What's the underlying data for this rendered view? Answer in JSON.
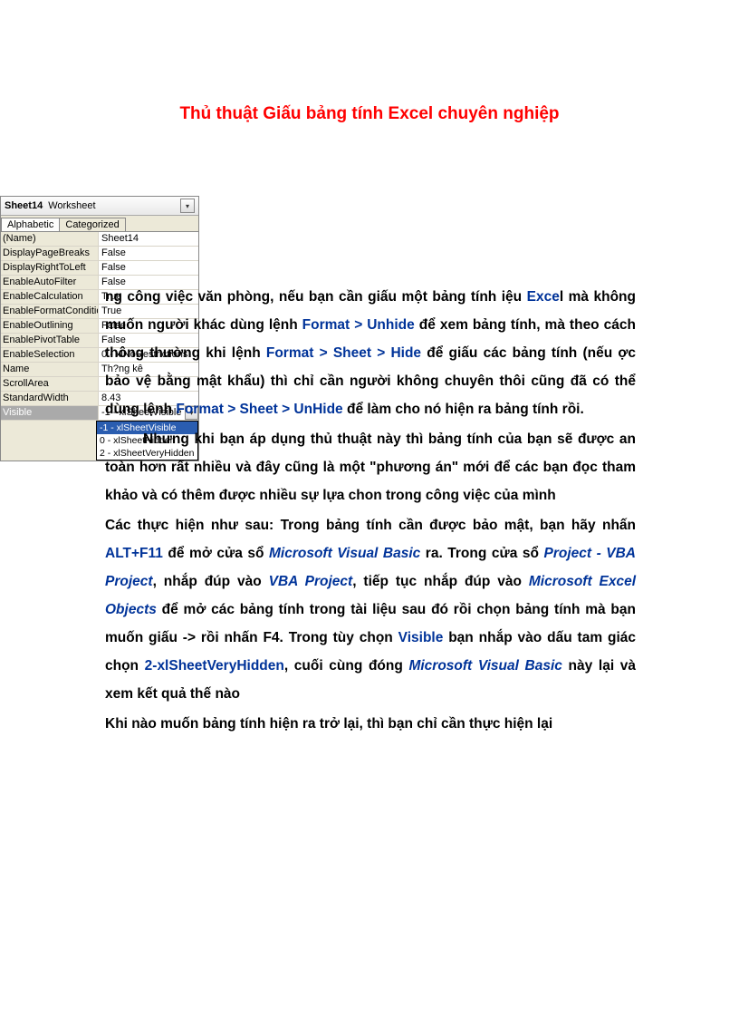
{
  "title": "Thủ thuật Giấu bảng tính Excel chuyên nghiệp",
  "panel": {
    "header_bold": "Sheet14",
    "header_plain": "Worksheet",
    "tab_alpha": "Alphabetic",
    "tab_cat": "Categorized",
    "rows": [
      {
        "k": "(Name)",
        "v": "Sheet14"
      },
      {
        "k": "DisplayPageBreaks",
        "v": "False"
      },
      {
        "k": "DisplayRightToLeft",
        "v": "False"
      },
      {
        "k": "EnableAutoFilter",
        "v": "False"
      },
      {
        "k": "EnableCalculation",
        "v": "True"
      },
      {
        "k": "EnableFormatConditions",
        "v": "True"
      },
      {
        "k": "EnableOutlining",
        "v": "False"
      },
      {
        "k": "EnablePivotTable",
        "v": "False"
      },
      {
        "k": "EnableSelection",
        "v": "0 - xlNoRestrictions"
      },
      {
        "k": "Name",
        "v": "Th?ng kê"
      },
      {
        "k": "ScrollArea",
        "v": ""
      },
      {
        "k": "StandardWidth",
        "v": "8.43"
      }
    ],
    "sel_key": "Visible",
    "sel_val": "-1 - xlSheetVisible",
    "dd0": "-1 - xlSheetVisible",
    "dd1": "0 - xlSheetHidden",
    "dd2": "2 - xlSheetVeryHidden"
  },
  "p1": {
    "a": "ng công việc văn phòng, nếu bạn cần giấu một bảng tính iệu ",
    "excel": "Exce",
    "excel_l": "l",
    "b": " mà không muốn người khác dùng lệnh ",
    "fmt1": "Format > Unhide",
    "c": " để xem bảng tính, mà theo cách thông thường khi lệnh ",
    "fmt2": "Format > Sheet > Hide",
    "d": " để giấu các bảng tính (nếu ợc bảo vệ bằng mật khẩu) thì chỉ cần người không chuyên thôi cũng đã có thể dùng lệnh ",
    "fmt3": "Format > Sheet > UnHide",
    "e": " để làm cho nó hiện ra bảng tính rồi."
  },
  "p2": "Nhưng khi bạn áp dụng thủ thuật này thì bảng tính của bạn sẽ được an toàn hơn rất nhiều và đây cũng là một \"phương án\" mới để các bạn đọc tham khảo và có thêm được nhiều sự lựa chon trong công việc của mình",
  "p3": {
    "a": "Các thực hiện như sau: Trong bảng tính cần được bảo mật, bạn hãy nhấn ",
    "alt": "ALT+F11",
    "b": " để mở cửa sổ ",
    "mvb": "Microsoft Visual Basic",
    "c": " ra. Trong cửa sổ ",
    "proj1": "Project - VBA Project",
    "d": ", nhắp đúp vào ",
    "proj2": "VBA Project",
    "e": ", tiếp tục nhắp đúp vào ",
    "meo": "Microsoft Excel Objects",
    "f": " để mở các bảng tính trong tài liệu sau đó rồi chọn bảng tính mà bạn muốn giấu -> rồi nhấn F4. Trong tùy chọn ",
    "vis": "Visible",
    "g": " bạn nhắp vào dấu tam giác chọn ",
    "hid": "2-xlSheetVeryHidden",
    "h": ", cuối cùng đóng ",
    "mvb2": "Microsoft Visual Basic",
    "i": " này lại và xem kết quả thế nào"
  },
  "p4": "Khi nào muốn bảng tính hiện ra trở lại, thì bạn chỉ cần thực hiện lại"
}
